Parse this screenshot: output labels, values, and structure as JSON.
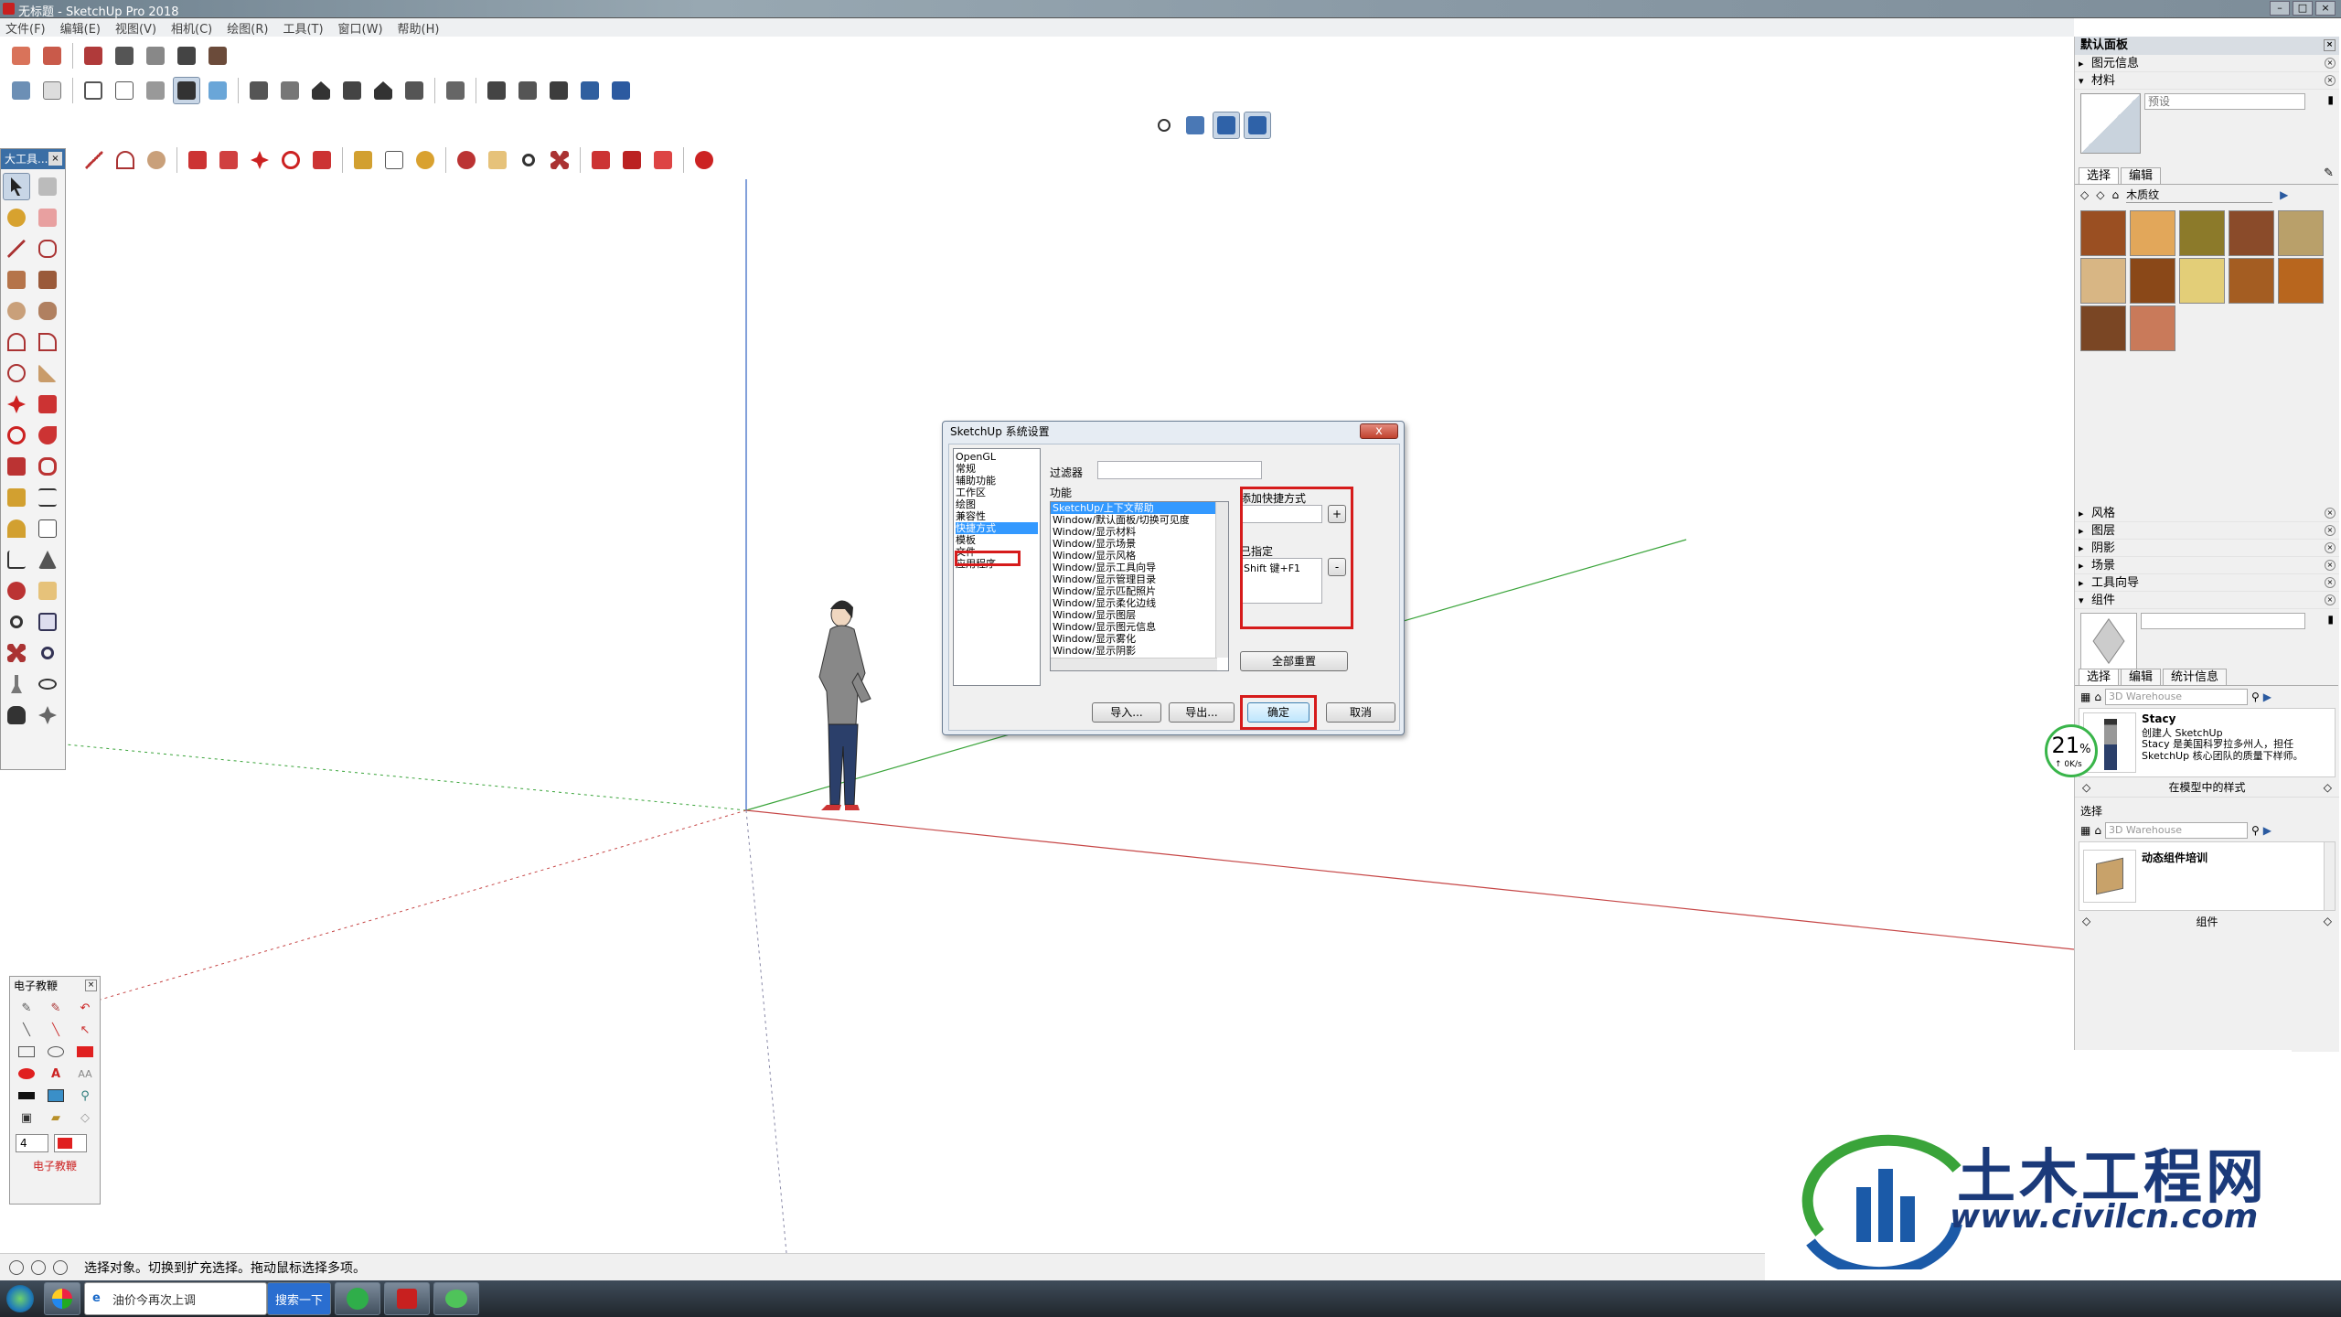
{
  "window": {
    "title": "无标题 - SketchUp Pro 2018",
    "btn_min": "–",
    "btn_max": "□",
    "btn_close": "×"
  },
  "menu": [
    "文件(F)",
    "编辑(E)",
    "视图(V)",
    "相机(C)",
    "绘图(R)",
    "工具(T)",
    "窗口(W)",
    "帮助(H)"
  ],
  "large_toolset": {
    "title": "大工具...",
    "close": "×"
  },
  "dialog": {
    "title": "SketchUp 系统设置",
    "close": "x",
    "categories": [
      "OpenGL",
      "常规",
      "辅助功能",
      "工作区",
      "绘图",
      "兼容性",
      "快捷方式",
      "模板",
      "文件",
      "应用程序"
    ],
    "selected_category": "快捷方式",
    "filter_label": "过滤器",
    "filter_value": "",
    "function_label": "功能",
    "functions": [
      "SketchUp/上下文帮助",
      "Window/默认面板/切换可见度",
      "Window/显示材料",
      "Window/显示场景",
      "Window/显示风格",
      "Window/显示工具向导",
      "Window/显示管理目录",
      "Window/显示匹配照片",
      "Window/显示柔化边线",
      "Window/显示图层",
      "Window/显示图元信息",
      "Window/显示雾化",
      "Window/显示阴影"
    ],
    "selected_function": "SketchUp/上下文帮助",
    "add_shortcut_label": "添加快捷方式",
    "add_btn": "+",
    "assigned_label": "已指定",
    "assigned_value": "Shift 键+F1",
    "remove_btn": "-",
    "reset_all": "全部重置",
    "import": "导入...",
    "export": "导出...",
    "ok": "确定",
    "cancel": "取消"
  },
  "tutorial_panel": {
    "title": "电子教鞭",
    "close": "×",
    "size_value": "4",
    "footer": "电子教鞭"
  },
  "right_panel": {
    "title": "默认面板",
    "entity_info": "图元信息",
    "materials": "材料",
    "preset": "预设",
    "tab_select": "选择",
    "tab_edit": "编辑",
    "library": "木质纹",
    "sections": [
      "风格",
      "图层",
      "阴影",
      "场景",
      "工具向导"
    ],
    "components": "组件",
    "comp_tabs": [
      "选择",
      "编辑",
      "统计信息"
    ],
    "search_placeholder": "3D Warehouse",
    "item_name": "Stacy",
    "item_desc1": "创建人 SketchUp",
    "item_desc2": "Stacy 是美国科罗拉多州人，担任 SketchUp 核心团队的质量下样师。",
    "in_model_label": "在模型中的样式",
    "select2": "选择",
    "search2_placeholder": "3D Warehouse",
    "item2_name": "动态组件培训",
    "comp_footer": "组件"
  },
  "network_widget": {
    "percent": "21",
    "unit": "%",
    "speed": "↑ 0K/s"
  },
  "status": {
    "text": "选择对象。切换到扩充选择。拖动鼠标选择多项。"
  },
  "taskbar": {
    "ie_label": "油价今再次上调",
    "search_btn": "搜索一下"
  },
  "watermark": {
    "brand": "土木工程网",
    "url": "www.civilcn.com"
  },
  "colors": {
    "accent_red": "#d61b1b",
    "selection_blue": "#3399ff",
    "axis_red": "#c64646",
    "axis_green": "#3aa43a",
    "brand_blue": "#1b3a7a"
  }
}
